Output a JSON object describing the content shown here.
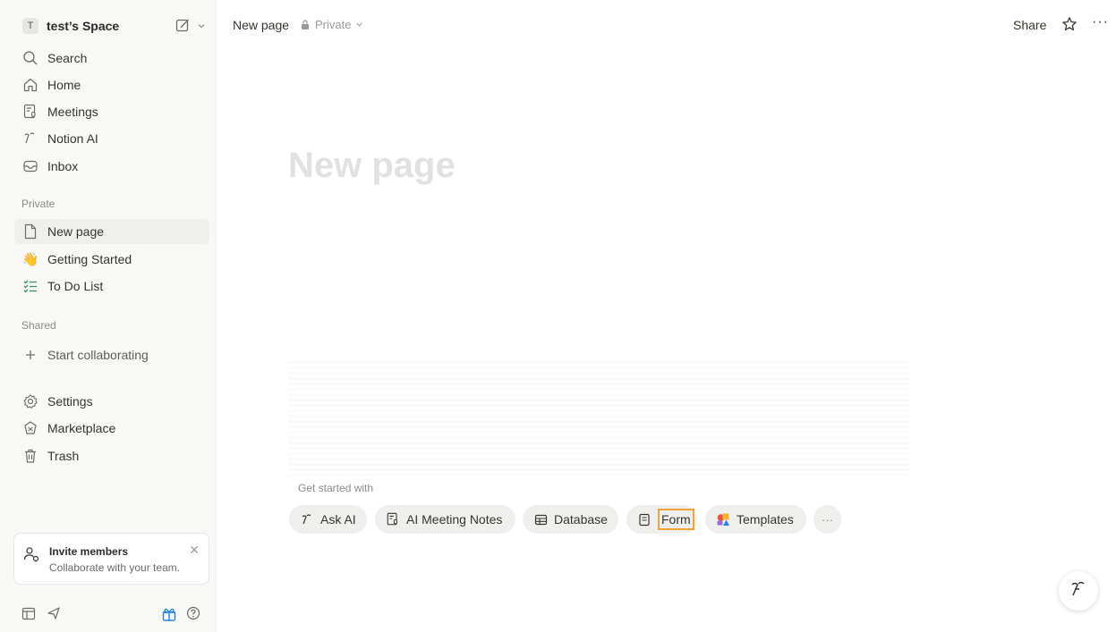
{
  "sidebar": {
    "workspace": {
      "initial": "T",
      "name": "test’s Space"
    },
    "top_items": [
      {
        "label": "Search",
        "icon": "search-icon"
      },
      {
        "label": "Home",
        "icon": "home-icon"
      },
      {
        "label": "Meetings",
        "icon": "meetings-icon"
      },
      {
        "label": "Notion AI",
        "icon": "notion-ai-icon"
      },
      {
        "label": "Inbox",
        "icon": "inbox-icon"
      }
    ],
    "private_label": "Private",
    "private_items": [
      {
        "label": "New page",
        "icon": "page-icon"
      },
      {
        "label": "Getting Started",
        "icon": "wave-emoji-icon"
      },
      {
        "label": "To Do List",
        "icon": "todo-list-icon"
      }
    ],
    "shared_label": "Shared",
    "shared_items": [
      {
        "label": "Start collaborating",
        "icon": "plus-icon"
      }
    ],
    "bottom_items": [
      {
        "label": "Settings",
        "icon": "settings-icon"
      },
      {
        "label": "Marketplace",
        "icon": "marketplace-icon"
      },
      {
        "label": "Trash",
        "icon": "trash-icon"
      }
    ],
    "invite": {
      "title": "Invite members",
      "subtitle": "Collaborate with your team."
    }
  },
  "topbar": {
    "title": "New page",
    "privacy": "Private",
    "share": "Share"
  },
  "page": {
    "title": "New page",
    "get_started_label": "Get started with",
    "chips": [
      {
        "label": "Ask AI",
        "icon": "notion-ai-icon"
      },
      {
        "label": "AI Meeting Notes",
        "icon": "meetings-icon"
      },
      {
        "label": "Database",
        "icon": "table-icon"
      },
      {
        "label": "Form",
        "icon": "form-icon"
      },
      {
        "label": "Templates",
        "icon": "templates-icon"
      }
    ]
  },
  "colors": {
    "highlight": "#f2a23a",
    "accent": "#2383e2"
  }
}
